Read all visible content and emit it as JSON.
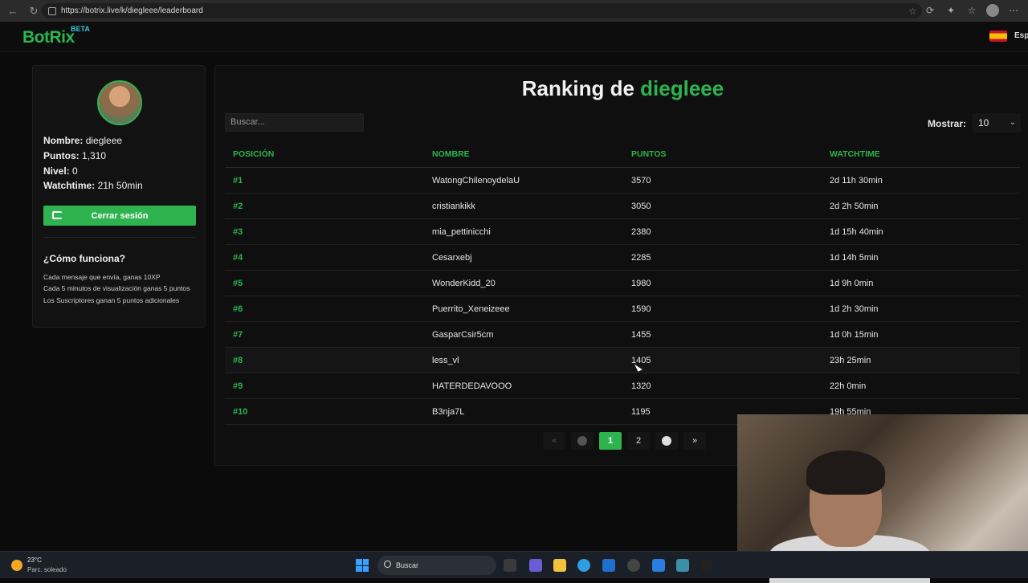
{
  "browser": {
    "url": "https://botrix.live/k/diegleee/leaderboard"
  },
  "header": {
    "logo": "BotRix",
    "beta": "BETA",
    "language": "Esp"
  },
  "sidebar": {
    "name_label": "Nombre:",
    "name_value": "diegleee",
    "points_label": "Puntos:",
    "points_value": "1,310",
    "level_label": "Nivel:",
    "level_value": "0",
    "watchtime_label": "Watchtime:",
    "watchtime_value": "21h 50min",
    "logout_label": "Cerrar sesión",
    "how_title": "¿Cómo funciona?",
    "how_lines": [
      "Cada mensaje que envía, ganas 10XP",
      "Cada 5 minutos de visualización ganas 5 puntos",
      "Los Suscriptores ganan 5 puntos adicionales"
    ]
  },
  "main": {
    "title_prefix": "Ranking de",
    "title_user": "diegleee",
    "search_placeholder": "Buscar...",
    "show_label": "Mostrar:",
    "show_value": "10",
    "columns": [
      "POSICIÓN",
      "NOMBRE",
      "PUNTOS",
      "WATCHTIME"
    ],
    "rows": [
      {
        "pos": "#1",
        "name": "WatongChilenoydelaU",
        "points": "3570",
        "watchtime": "2d 11h 30min"
      },
      {
        "pos": "#2",
        "name": "cristiankikk",
        "points": "3050",
        "watchtime": "2d 2h 50min"
      },
      {
        "pos": "#3",
        "name": "mia_pettinicchi",
        "points": "2380",
        "watchtime": "1d 15h 40min"
      },
      {
        "pos": "#4",
        "name": "Cesarxebj",
        "points": "2285",
        "watchtime": "1d 14h 5min"
      },
      {
        "pos": "#5",
        "name": "WonderKidd_20",
        "points": "1980",
        "watchtime": "1d 9h 0min"
      },
      {
        "pos": "#6",
        "name": "Puerrito_Xeneizeee",
        "points": "1590",
        "watchtime": "1d 2h 30min"
      },
      {
        "pos": "#7",
        "name": "GasparCsir5cm",
        "points": "1455",
        "watchtime": "1d 0h 15min"
      },
      {
        "pos": "#8",
        "name": "less_vl",
        "points": "1405",
        "watchtime": "23h 25min"
      },
      {
        "pos": "#9",
        "name": "HATERDEDAVOOO",
        "points": "1320",
        "watchtime": "22h 0min"
      },
      {
        "pos": "#10",
        "name": "B3nja7L",
        "points": "1195",
        "watchtime": "19h 55min"
      }
    ],
    "pager": {
      "first": "«",
      "last": "»",
      "pages": [
        "1",
        "2"
      ]
    }
  },
  "taskbar": {
    "temperature": "23°C",
    "weather": "Parc. soleado",
    "search_label": "Buscar"
  },
  "colors": {
    "accent": "#2fb34f",
    "background": "#0b0b0b",
    "panel": "#121212"
  }
}
